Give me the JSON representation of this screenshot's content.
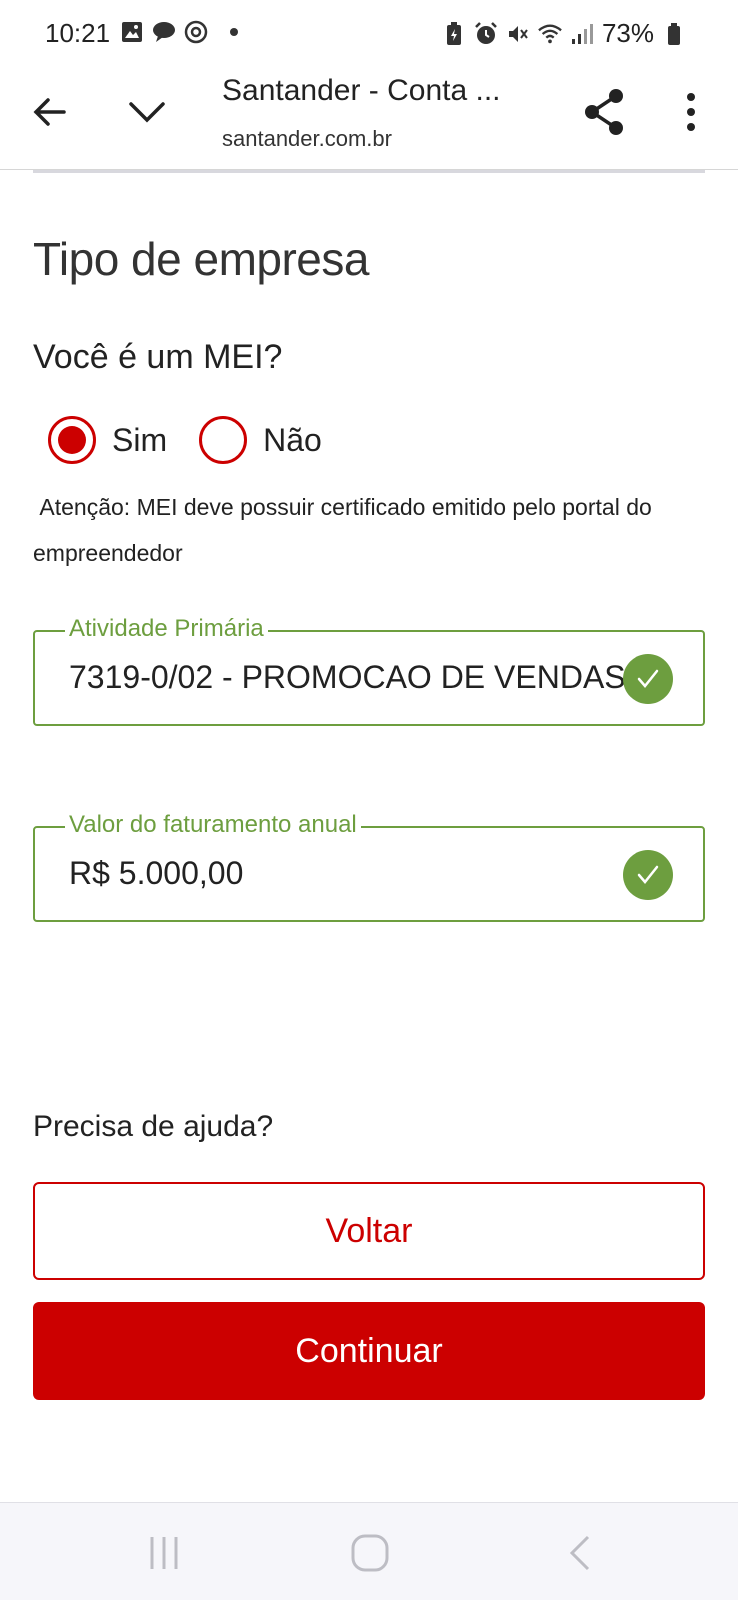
{
  "status_bar": {
    "time": "10:21",
    "battery": "73%"
  },
  "toolbar": {
    "title": "Santander - Conta ...",
    "url": "santander.com.br"
  },
  "page": {
    "section_title": "Tipo de empresa",
    "question": "Você é um MEI?",
    "radio_options": [
      {
        "label": "Sim",
        "selected": true
      },
      {
        "label": "Não",
        "selected": false
      }
    ],
    "notice": " Atenção: MEI deve possuir certificado emitido pelo portal do empreendedor",
    "fields": [
      {
        "label": "Atividade Primária",
        "value": "7319-0/02 - PROMOCAO DE VENDAS",
        "valid": true
      },
      {
        "label": "Valor do faturamento anual",
        "value": "R$ 5.000,00",
        "valid": true
      }
    ],
    "help_text": "Precisa de ajuda?",
    "back_button": "Voltar",
    "continue_button": "Continuar"
  },
  "colors": {
    "brand": "#cc0000",
    "valid": "#6d9e3f"
  }
}
